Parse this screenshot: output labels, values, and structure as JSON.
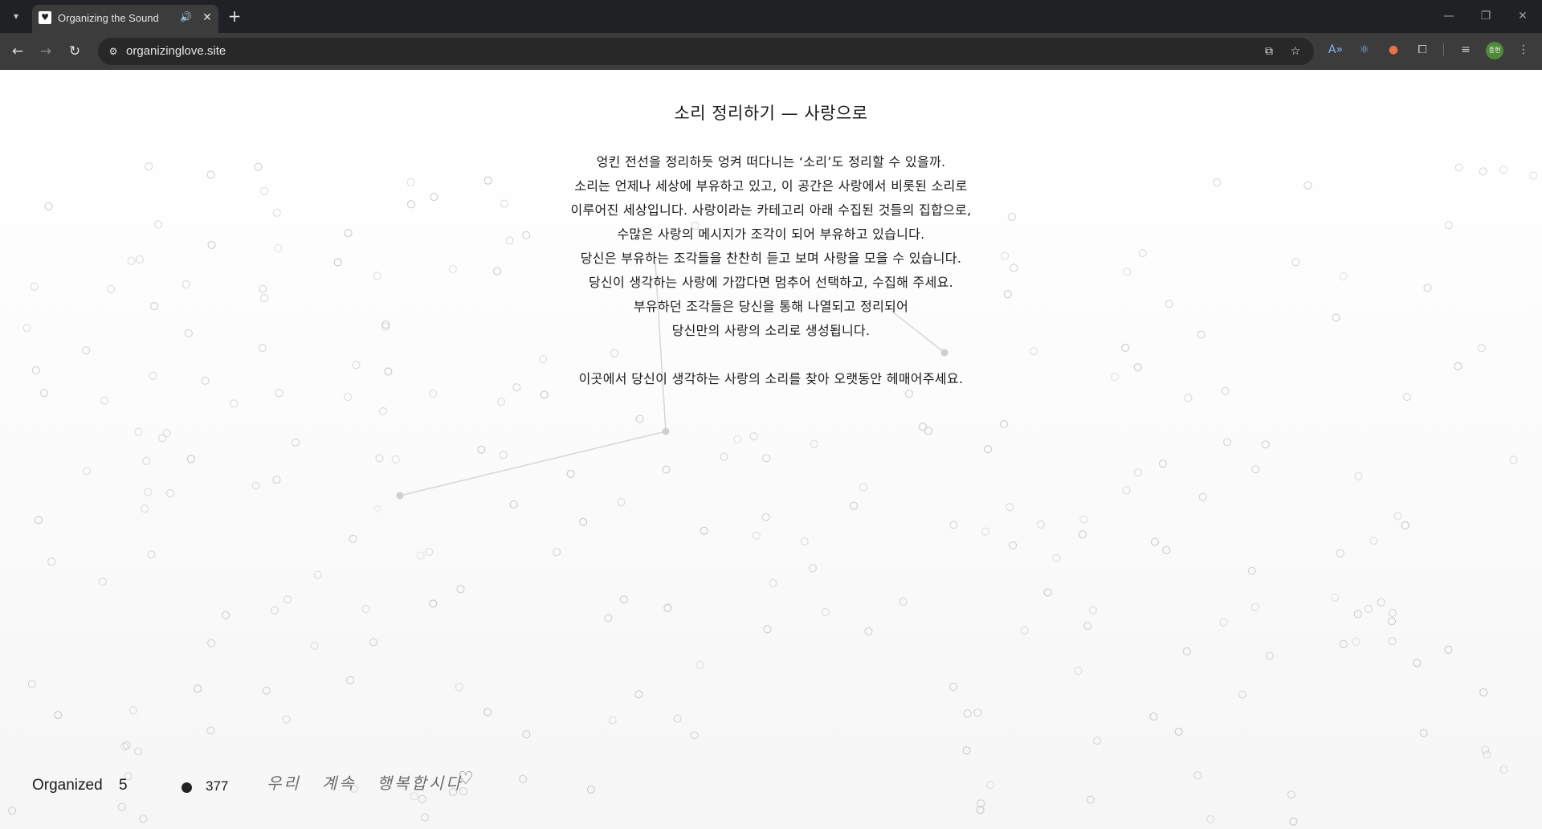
{
  "browser": {
    "tab_title": "Organizing the Sound",
    "url": "organizinglove.site",
    "profile_initials": "종현"
  },
  "page": {
    "heading": "소리 정리하기 — 사랑으로",
    "intro_lines": [
      "엉킨 전선을 정리하듯 엉켜 떠다니는 ‘소리’도 정리할 수 있을까.",
      "소리는 언제나 세상에 부유하고 있고, 이 공간은 사랑에서 비롯된 소리로",
      "이루어진 세상입니다. 사랑이라는 카테고리 아래 수집된 것들의 집합으로,",
      "수많은 사랑의 메시지가 조각이 되어 부유하고 있습니다.",
      "당신은 부유하는 조각들을 찬찬히 듣고 보며 사랑을 모을 수 있습니다.",
      "당신이 생각하는 사랑에 가깝다면 멈추어 선택하고, 수집해 주세요.",
      "부유하던 조각들은 당신을 통해 나열되고 정리되어",
      "당신만의 사랑의 소리로 생성됩니다."
    ],
    "closing_line": "이곳에서 당신이 생각하는 사랑의 소리를 찾아 오랫동안 헤매어주세요."
  },
  "footer": {
    "organized_label": "Organized",
    "organized_count": "5",
    "dot_count": "377",
    "handwriting_words": [
      "우리",
      "계속",
      "행복합시다"
    ]
  },
  "colors": {
    "chrome_dark": "#202124",
    "chrome_toolbar": "#3c3c3c",
    "text": "#1a1a1a",
    "particle": "#bcbcbc"
  }
}
